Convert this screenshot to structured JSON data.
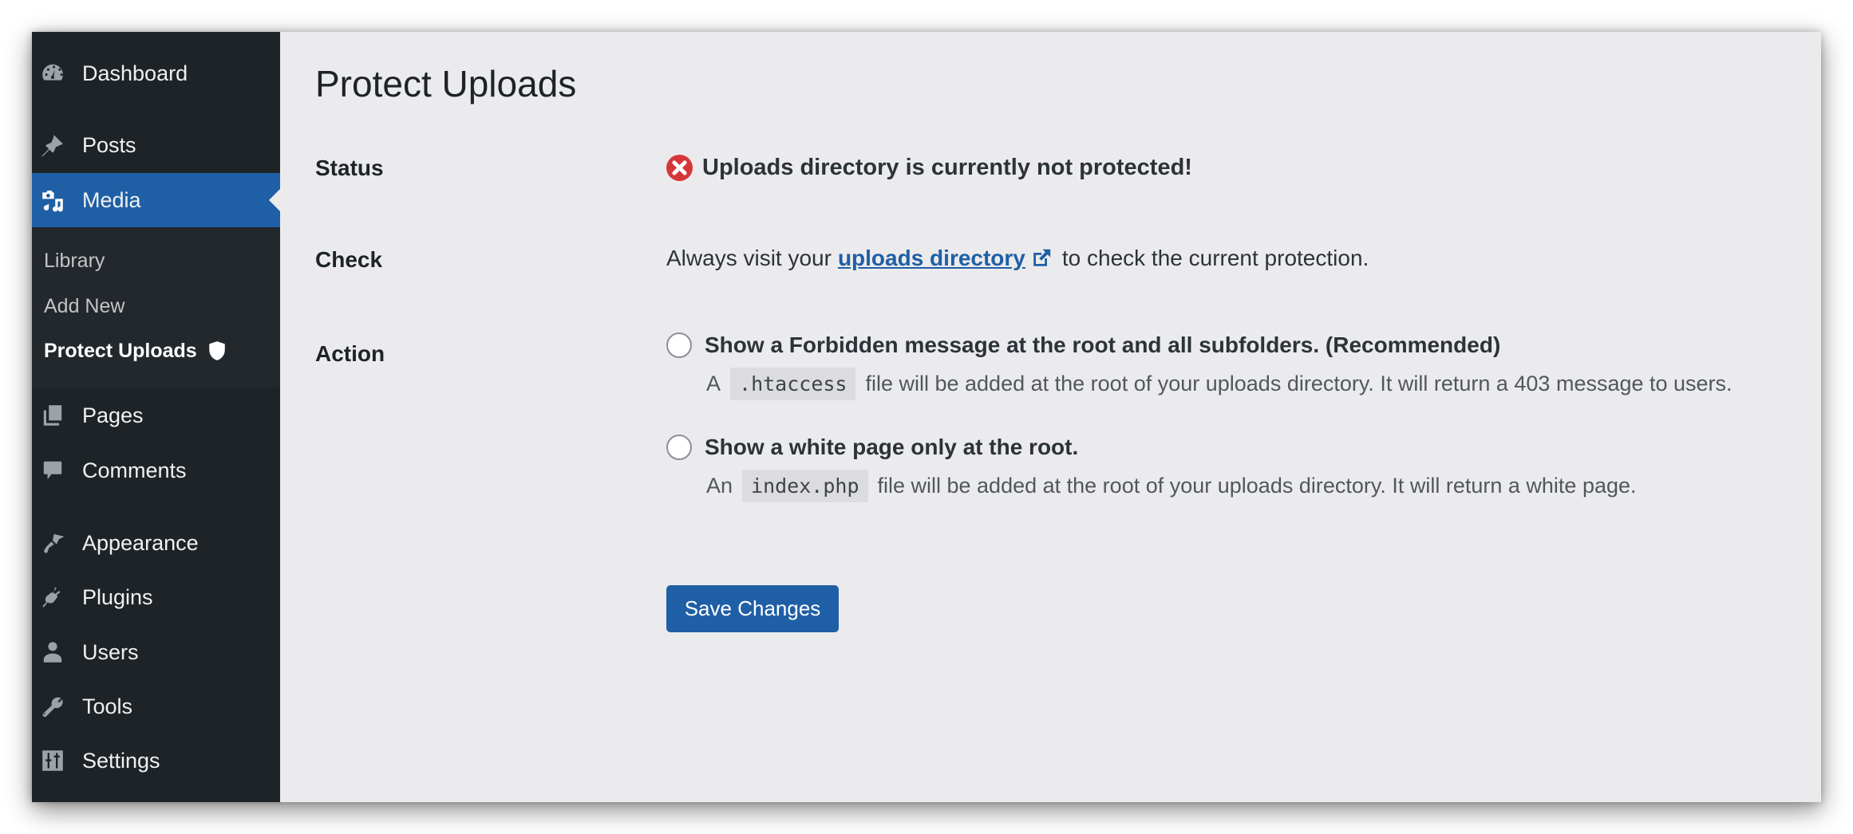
{
  "sidebar": {
    "items": [
      {
        "label": "Dashboard",
        "icon": "dashboard-icon"
      },
      {
        "label": "Posts",
        "icon": "pin-icon"
      },
      {
        "label": "Media",
        "icon": "media-icon",
        "current": true
      },
      {
        "label": "Pages",
        "icon": "pages-icon"
      },
      {
        "label": "Comments",
        "icon": "comment-icon"
      },
      {
        "label": "Appearance",
        "icon": "paintbrush-icon"
      },
      {
        "label": "Plugins",
        "icon": "plug-icon"
      },
      {
        "label": "Users",
        "icon": "user-icon"
      },
      {
        "label": "Tools",
        "icon": "wrench-icon"
      },
      {
        "label": "Settings",
        "icon": "settings-icon"
      }
    ],
    "submenu": [
      {
        "label": "Library"
      },
      {
        "label": "Add New"
      },
      {
        "label": "Protect Uploads",
        "current": true,
        "icon": "shield-icon"
      }
    ]
  },
  "page": {
    "title": "Protect Uploads",
    "rows": {
      "status_label": "Status",
      "check_label": "Check",
      "action_label": "Action"
    },
    "status": {
      "icon": "error-icon",
      "message": "Uploads directory is currently not protected!"
    },
    "check": {
      "prefix": "Always visit your",
      "link_text": "uploads directory",
      "link_icon": "external-link-icon",
      "suffix": "to check the current protection."
    },
    "options": [
      {
        "label": "Show a Forbidden message at the root and all subfolders. (Recommended)",
        "checked": false,
        "desc_prefix": "A",
        "desc_code": ".htaccess",
        "desc_suffix": "file will be added at the root of your uploads directory. It will return a 403 message to users."
      },
      {
        "label": "Show a white page only at the root.",
        "checked": false,
        "desc_prefix": "An",
        "desc_code": "index.php",
        "desc_suffix": "file will be added at the root of your uploads directory. It will return a white page."
      }
    ],
    "save_label": "Save Changes"
  },
  "colors": {
    "sidebar_bg": "#1d2327",
    "accent": "#1f5fa6",
    "error": "#d63638",
    "content_bg": "#ebebed"
  }
}
